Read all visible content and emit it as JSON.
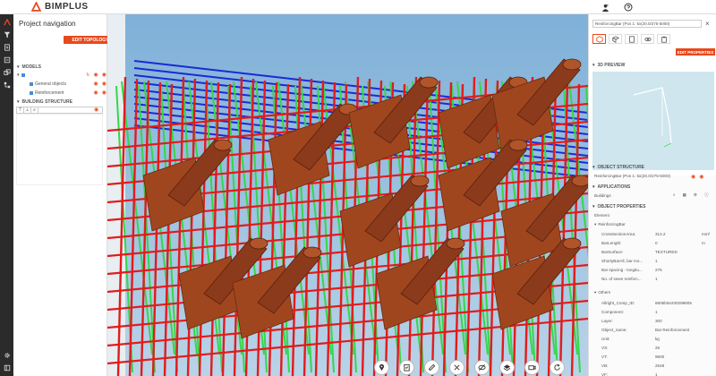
{
  "app": {
    "brand": "BIMPLUS"
  },
  "nav": {
    "title": "Project navigation",
    "edit_topology": "EDIT TOPOLOGY",
    "models_label": "MODELS",
    "model_items": [
      "General objects",
      "Reinforcement"
    ],
    "building_structure_label": "BUILDING STRUCTURE"
  },
  "props": {
    "selected_object": "ReinforcingBar (Pos 1: 5x(20.0/275-5000)",
    "edit_properties": "EDIT PROPERTIES",
    "preview_label": "3D PREVIEW",
    "object_structure_label": "OBJECT STRUCTURE",
    "object_structure_item": "ReinforcingBar (Pos 1: 5x(20.0/275-5000)",
    "applications_label": "APPLICATIONS",
    "buildings_label": "Buildings",
    "object_properties_label": "OBJECT PROPERTIES",
    "element_label": "Element",
    "group_label": "ReinforcingBar",
    "rows": [
      {
        "k": "CrossSectionArea:",
        "v": "314.2",
        "u": "mm²"
      },
      {
        "k": "BarLength:",
        "v": "0",
        "u": "m"
      },
      {
        "k": "BarSurface:",
        "v": "TEXTURED",
        "u": ""
      },
      {
        "k": "ShortyBarAll, bar mo...",
        "v": "1",
        "u": ""
      },
      {
        "k": "Bar spacing - longitu...",
        "v": "275",
        "u": ""
      },
      {
        "k": "No. of sewn reinforc...",
        "v": "1",
        "u": ""
      }
    ],
    "others_label": "Others",
    "other_rows": [
      {
        "k": "Allright_Comp_ID:",
        "v": "6605b0e200298605",
        "u": ""
      },
      {
        "k": "Component:",
        "v": "1",
        "u": ""
      },
      {
        "k": "Layer:",
        "v": "300",
        "u": ""
      },
      {
        "k": "Object_name:",
        "v": "Bar Reinforcement",
        "u": ""
      },
      {
        "k": "Unit:",
        "v": "kg",
        "u": ""
      },
      {
        "k": "VS:",
        "v": "26",
        "u": ""
      },
      {
        "k": "VT:",
        "v": "9600",
        "u": ""
      },
      {
        "k": "VB:",
        "v": "2648",
        "u": ""
      },
      {
        "k": "VF:",
        "v": "1",
        "u": ""
      }
    ]
  },
  "colors": {
    "accent": "#e8491d",
    "rail": "#2b2b2b",
    "rebar_red": "#e01c1c",
    "rebar_green": "#36d64a",
    "rebar_blue": "#1a2ad6",
    "concrete": "#8b3a1c"
  },
  "bottom_toolbar_icons": [
    "pin-icon",
    "clipboard-icon",
    "ruler-icon",
    "cross-arrows-icon",
    "hide-icon",
    "layers-icon",
    "camera-icon",
    "rotate-icon"
  ]
}
